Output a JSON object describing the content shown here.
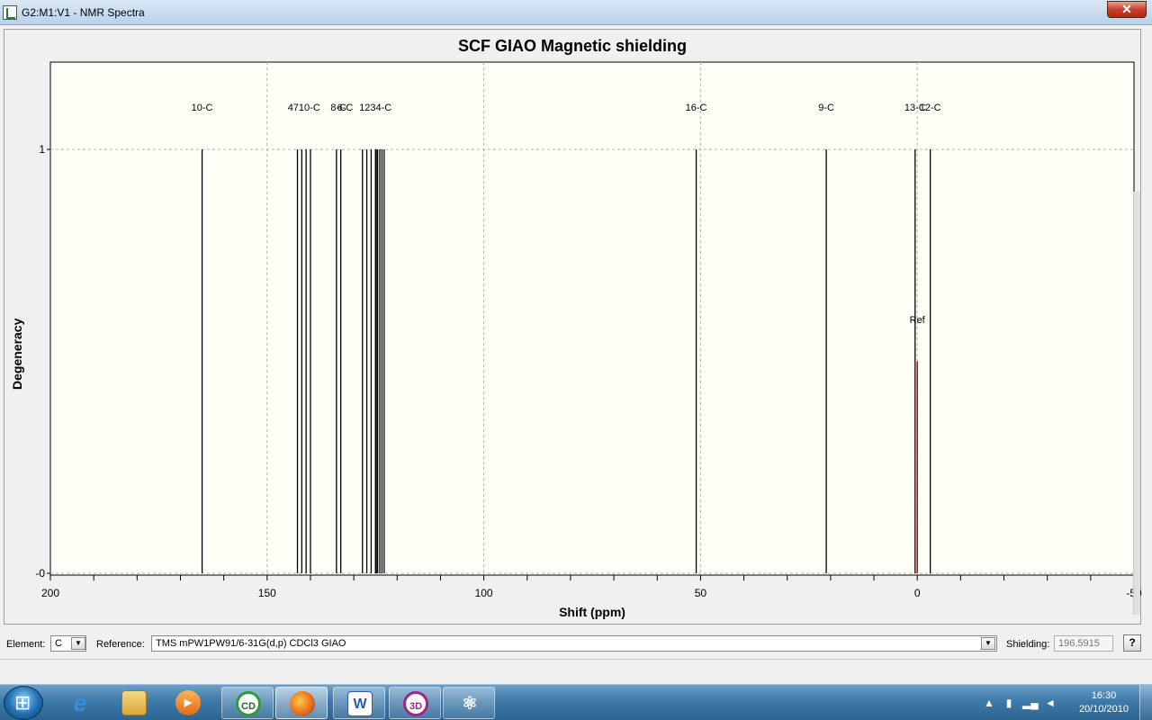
{
  "window": {
    "title": "G2:M1:V1 - NMR Spectra",
    "close_label": "✕"
  },
  "chart_data": {
    "type": "bar",
    "title": "SCF GIAO Magnetic shielding",
    "xlabel": "Shift (ppm)",
    "ylabel": "Degeneracy",
    "xlim": [
      200,
      -50
    ],
    "ylim": [
      0,
      1
    ],
    "x_ticks": [
      200,
      150,
      100,
      50,
      0,
      -50
    ],
    "y_ticks": [
      "1",
      "-0"
    ],
    "grid": true,
    "series": [
      {
        "name": "",
        "x": [
          165,
          143,
          142,
          141,
          140,
          134,
          133,
          128,
          127,
          126,
          125,
          124.8,
          124.5,
          124,
          123.5,
          123,
          51,
          21,
          0.5,
          -3
        ],
        "values": [
          1,
          1,
          1,
          1,
          1,
          1,
          1,
          1,
          1,
          1,
          1,
          1,
          1,
          1,
          1,
          1,
          1,
          1,
          1,
          1
        ],
        "color": "#000000"
      },
      {
        "name": "",
        "x": [
          0
        ],
        "values": [
          0.5
        ],
        "color": "#c00000"
      }
    ],
    "peak_labels": [
      {
        "x": 165,
        "text": "10-C"
      },
      {
        "x": 141.5,
        "text": "4710-C"
      },
      {
        "x": 133.5,
        "text": "8-C"
      },
      {
        "x": 132,
        "text": "6-C"
      },
      {
        "x": 125,
        "text": "1234-C"
      },
      {
        "x": 51,
        "text": "16-C"
      },
      {
        "x": 21,
        "text": "9-C"
      },
      {
        "x": 0.5,
        "text": "13-C"
      },
      {
        "x": -3,
        "text": "12-C"
      },
      {
        "x": 0,
        "text": "Ref"
      }
    ]
  },
  "controls": {
    "element_label": "Element:",
    "element_value": "C",
    "reference_label": "Reference:",
    "reference_value": "TMS mPW1PW91/6-31G(d,p) CDCl3 GIAO",
    "shielding_label": "Shielding:",
    "shielding_value": "196.5915",
    "help_label": "?"
  },
  "taskbar": {
    "time": "16:30",
    "date": "20/10/2010",
    "apps": [
      "internet-explorer",
      "windows-explorer",
      "media-player",
      "chemsketch",
      "firefox",
      "word",
      "3d-viewer",
      "gaussview"
    ]
  }
}
